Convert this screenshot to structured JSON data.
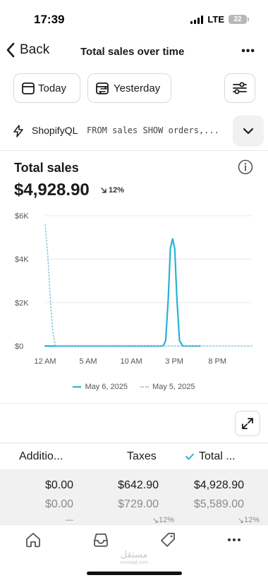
{
  "status_bar": {
    "time": "17:39",
    "network": "LTE",
    "battery": "22"
  },
  "nav": {
    "back_label": "Back",
    "title": "Total sales over time"
  },
  "filters": {
    "today": "Today",
    "yesterday": "Yesterday"
  },
  "query": {
    "label": "ShopifyQL",
    "code": "FROM sales SHOW orders,..."
  },
  "card": {
    "title": "Total sales",
    "value": "$4,928.90",
    "change": "12%"
  },
  "chart_data": {
    "type": "line",
    "x_ticks": [
      "12 AM",
      "5 AM",
      "10 AM",
      "3 PM",
      "8 PM"
    ],
    "y_ticks": [
      "$0",
      "$2K",
      "$4K",
      "$6K"
    ],
    "ylim": [
      0,
      6000
    ],
    "x_hours": [
      0,
      24
    ],
    "grid": true,
    "legend_position": "bottom",
    "series": [
      {
        "name": "May 6, 2025",
        "style": "solid",
        "color": "#2bb0d6",
        "points": [
          [
            0,
            0
          ],
          [
            13,
            0
          ],
          [
            13.7,
            0
          ],
          [
            14,
            250
          ],
          [
            14.3,
            2200
          ],
          [
            14.55,
            4500
          ],
          [
            14.8,
            4929
          ],
          [
            15.05,
            4500
          ],
          [
            15.3,
            2200
          ],
          [
            15.6,
            250
          ],
          [
            16,
            0
          ],
          [
            18,
            0
          ]
        ]
      },
      {
        "name": "May 5, 2025",
        "style": "dotted",
        "color": "#8cc7d9",
        "points": [
          [
            0,
            5589
          ],
          [
            0.3,
            4200
          ],
          [
            0.6,
            2200
          ],
          [
            0.9,
            600
          ],
          [
            1.2,
            0
          ],
          [
            24,
            0
          ]
        ]
      }
    ]
  },
  "table": {
    "headers": [
      "Additio...",
      "Taxes",
      "Total ..."
    ],
    "rows": [
      [
        "$0.00",
        "$642.90",
        "$4,928.90"
      ],
      [
        "$0.00",
        "$729.00",
        "$5,589.00"
      ],
      [
        "—",
        "12%",
        "12%"
      ]
    ]
  },
  "colors": {
    "accent": "#2bb0d6",
    "comparison": "#8cc7d9",
    "check": "#2bb0d6"
  },
  "watermark": {
    "arabic": "مستقل",
    "latin": "mostaql.com"
  }
}
